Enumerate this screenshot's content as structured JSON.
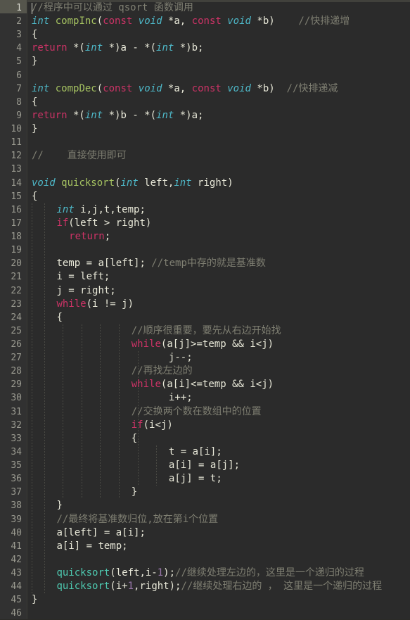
{
  "editor": {
    "name": "code-editor",
    "language": "C",
    "total_lines": 46,
    "active_line": 1,
    "theme": {
      "background": "#2b2b2b",
      "gutter_background": "#313131",
      "gutter_active": "#55554c",
      "foreground": "#e8e8d8",
      "comment": "#7f7f72",
      "keyword": "#cc3366",
      "type": "#4eb8c8",
      "function_def": "#a5c261",
      "function_call": "#4ec9b0",
      "number": "#9876aa",
      "indent_guide": "#4a4a44"
    }
  },
  "gutter": {
    "line_numbers": [
      "1",
      "2",
      "3",
      "4",
      "5",
      "6",
      "7",
      "8",
      "9",
      "10",
      "11",
      "12",
      "13",
      "14",
      "15",
      "16",
      "17",
      "18",
      "19",
      "20",
      "21",
      "22",
      "23",
      "24",
      "25",
      "26",
      "27",
      "28",
      "29",
      "30",
      "31",
      "32",
      "33",
      "34",
      "35",
      "36",
      "37",
      "38",
      "39",
      "40",
      "41",
      "42",
      "43",
      "44",
      "45",
      "46"
    ]
  },
  "lines": [
    {
      "n": 1,
      "indent": 0,
      "tokens": [
        {
          "t": "cmt",
          "s": "//程序中可以通过 qsort 函数调用"
        }
      ]
    },
    {
      "n": 2,
      "indent": 0,
      "tokens": [
        {
          "t": "type",
          "s": "int"
        },
        {
          "t": "plain",
          "s": " "
        },
        {
          "t": "fn",
          "s": "compInc"
        },
        {
          "t": "plain",
          "s": "("
        },
        {
          "t": "kw",
          "s": "const"
        },
        {
          "t": "plain",
          "s": " "
        },
        {
          "t": "type",
          "s": "void"
        },
        {
          "t": "plain",
          "s": " *a, "
        },
        {
          "t": "kw",
          "s": "const"
        },
        {
          "t": "plain",
          "s": " "
        },
        {
          "t": "type",
          "s": "void"
        },
        {
          "t": "plain",
          "s": " *b)    "
        },
        {
          "t": "cmt",
          "s": "//快排递增"
        }
      ]
    },
    {
      "n": 3,
      "indent": 0,
      "tokens": [
        {
          "t": "plain",
          "s": "{"
        }
      ]
    },
    {
      "n": 4,
      "indent": 0,
      "tokens": [
        {
          "t": "kw",
          "s": "return"
        },
        {
          "t": "plain",
          "s": " *("
        },
        {
          "t": "type",
          "s": "int"
        },
        {
          "t": "plain",
          "s": " *)a - *("
        },
        {
          "t": "type",
          "s": "int"
        },
        {
          "t": "plain",
          "s": " *)b;"
        }
      ]
    },
    {
      "n": 5,
      "indent": 0,
      "tokens": [
        {
          "t": "plain",
          "s": "}"
        }
      ]
    },
    {
      "n": 6,
      "indent": 0,
      "tokens": []
    },
    {
      "n": 7,
      "indent": 0,
      "tokens": [
        {
          "t": "type",
          "s": "int"
        },
        {
          "t": "plain",
          "s": " "
        },
        {
          "t": "fn",
          "s": "compDec"
        },
        {
          "t": "plain",
          "s": "("
        },
        {
          "t": "kw",
          "s": "const"
        },
        {
          "t": "plain",
          "s": " "
        },
        {
          "t": "type",
          "s": "void"
        },
        {
          "t": "plain",
          "s": " *a, "
        },
        {
          "t": "kw",
          "s": "const"
        },
        {
          "t": "plain",
          "s": " "
        },
        {
          "t": "type",
          "s": "void"
        },
        {
          "t": "plain",
          "s": " *b)  "
        },
        {
          "t": "cmt",
          "s": "//快排递减"
        }
      ]
    },
    {
      "n": 8,
      "indent": 0,
      "tokens": [
        {
          "t": "plain",
          "s": "{"
        }
      ]
    },
    {
      "n": 9,
      "indent": 0,
      "tokens": [
        {
          "t": "kw",
          "s": "return"
        },
        {
          "t": "plain",
          "s": " *("
        },
        {
          "t": "type",
          "s": "int"
        },
        {
          "t": "plain",
          "s": " *)b - *("
        },
        {
          "t": "type",
          "s": "int"
        },
        {
          "t": "plain",
          "s": " *)a;"
        }
      ]
    },
    {
      "n": 10,
      "indent": 0,
      "tokens": [
        {
          "t": "plain",
          "s": "}"
        }
      ]
    },
    {
      "n": 11,
      "indent": 0,
      "tokens": []
    },
    {
      "n": 12,
      "indent": 0,
      "tokens": [
        {
          "t": "cmt",
          "s": "//    直接使用即可"
        }
      ]
    },
    {
      "n": 13,
      "indent": 0,
      "tokens": []
    },
    {
      "n": 14,
      "indent": 0,
      "tokens": [
        {
          "t": "type",
          "s": "void"
        },
        {
          "t": "plain",
          "s": " "
        },
        {
          "t": "fn",
          "s": "quicksort"
        },
        {
          "t": "plain",
          "s": "("
        },
        {
          "t": "type",
          "s": "int"
        },
        {
          "t": "plain",
          "s": " left,"
        },
        {
          "t": "type",
          "s": "int"
        },
        {
          "t": "plain",
          "s": " right)"
        }
      ]
    },
    {
      "n": 15,
      "indent": 0,
      "tokens": [
        {
          "t": "plain",
          "s": "{"
        }
      ]
    },
    {
      "n": 16,
      "indent": 4,
      "tokens": [
        {
          "t": "type",
          "s": "int"
        },
        {
          "t": "plain",
          "s": " i,j,t,temp;"
        }
      ]
    },
    {
      "n": 17,
      "indent": 4,
      "tokens": [
        {
          "t": "kw",
          "s": "if"
        },
        {
          "t": "plain",
          "s": "(left > right)"
        }
      ]
    },
    {
      "n": 18,
      "indent": 6,
      "tokens": [
        {
          "t": "kw",
          "s": "return"
        },
        {
          "t": "plain",
          "s": ";"
        }
      ]
    },
    {
      "n": 19,
      "indent": 0,
      "tokens": []
    },
    {
      "n": 20,
      "indent": 4,
      "tokens": [
        {
          "t": "plain",
          "s": "temp = a[left]; "
        },
        {
          "t": "cmt",
          "s": "//temp中存的就是基准数"
        }
      ]
    },
    {
      "n": 21,
      "indent": 4,
      "tokens": [
        {
          "t": "plain",
          "s": "i = left;"
        }
      ]
    },
    {
      "n": 22,
      "indent": 4,
      "tokens": [
        {
          "t": "plain",
          "s": "j = right;"
        }
      ]
    },
    {
      "n": 23,
      "indent": 4,
      "tokens": [
        {
          "t": "kw",
          "s": "while"
        },
        {
          "t": "plain",
          "s": "(i != j)"
        }
      ]
    },
    {
      "n": 24,
      "indent": 4,
      "tokens": [
        {
          "t": "plain",
          "s": "{"
        }
      ]
    },
    {
      "n": 25,
      "indent": 16,
      "tokens": [
        {
          "t": "cmt",
          "s": "//顺序很重要，要先从右边开始找"
        }
      ]
    },
    {
      "n": 26,
      "indent": 16,
      "tokens": [
        {
          "t": "kw",
          "s": "while"
        },
        {
          "t": "plain",
          "s": "(a[j]>=temp && i<j)"
        }
      ]
    },
    {
      "n": 27,
      "indent": 22,
      "tokens": [
        {
          "t": "plain",
          "s": "j--;"
        }
      ]
    },
    {
      "n": 28,
      "indent": 16,
      "tokens": [
        {
          "t": "cmt",
          "s": "//再找左边的"
        }
      ]
    },
    {
      "n": 29,
      "indent": 16,
      "tokens": [
        {
          "t": "kw",
          "s": "while"
        },
        {
          "t": "plain",
          "s": "(a[i]<=temp && i<j)"
        }
      ]
    },
    {
      "n": 30,
      "indent": 22,
      "tokens": [
        {
          "t": "plain",
          "s": "i++;"
        }
      ]
    },
    {
      "n": 31,
      "indent": 16,
      "tokens": [
        {
          "t": "cmt",
          "s": "//交换两个数在数组中的位置"
        }
      ]
    },
    {
      "n": 32,
      "indent": 16,
      "tokens": [
        {
          "t": "kw",
          "s": "if"
        },
        {
          "t": "plain",
          "s": "(i<j)"
        }
      ]
    },
    {
      "n": 33,
      "indent": 16,
      "tokens": [
        {
          "t": "plain",
          "s": "{"
        }
      ]
    },
    {
      "n": 34,
      "indent": 22,
      "tokens": [
        {
          "t": "plain",
          "s": "t = a[i];"
        }
      ]
    },
    {
      "n": 35,
      "indent": 22,
      "tokens": [
        {
          "t": "plain",
          "s": "a[i] = a[j];"
        }
      ]
    },
    {
      "n": 36,
      "indent": 22,
      "tokens": [
        {
          "t": "plain",
          "s": "a[j] = t;"
        }
      ]
    },
    {
      "n": 37,
      "indent": 16,
      "tokens": [
        {
          "t": "plain",
          "s": "}"
        }
      ]
    },
    {
      "n": 38,
      "indent": 4,
      "tokens": [
        {
          "t": "plain",
          "s": "}"
        }
      ]
    },
    {
      "n": 39,
      "indent": 4,
      "tokens": [
        {
          "t": "cmt",
          "s": "//最终将基准数归位,放在第i个位置"
        }
      ]
    },
    {
      "n": 40,
      "indent": 4,
      "tokens": [
        {
          "t": "plain",
          "s": "a[left] = a[i];"
        }
      ]
    },
    {
      "n": 41,
      "indent": 4,
      "tokens": [
        {
          "t": "plain",
          "s": "a[i] = temp;"
        }
      ]
    },
    {
      "n": 42,
      "indent": 0,
      "tokens": []
    },
    {
      "n": 43,
      "indent": 4,
      "tokens": [
        {
          "t": "call",
          "s": "quicksort"
        },
        {
          "t": "plain",
          "s": "(left,i-"
        },
        {
          "t": "num",
          "s": "1"
        },
        {
          "t": "plain",
          "s": ");"
        },
        {
          "t": "cmt",
          "s": "//继续处理左边的，这里是一个递归的过程"
        }
      ]
    },
    {
      "n": 44,
      "indent": 4,
      "tokens": [
        {
          "t": "call",
          "s": "quicksort"
        },
        {
          "t": "plain",
          "s": "(i+"
        },
        {
          "t": "num",
          "s": "1"
        },
        {
          "t": "plain",
          "s": ",right);"
        },
        {
          "t": "cmt",
          "s": "//继续处理右边的 ， 这里是一个递归的过程"
        }
      ]
    },
    {
      "n": 45,
      "indent": 0,
      "tokens": [
        {
          "t": "plain",
          "s": "}"
        }
      ]
    },
    {
      "n": 46,
      "indent": 0,
      "tokens": []
    }
  ],
  "indent_guides": [
    {
      "col": 0,
      "from_line": 16,
      "to_line": 44
    },
    {
      "col": 2,
      "from_line": 16,
      "to_line": 44
    },
    {
      "col": 5,
      "from_line": 25,
      "to_line": 37
    },
    {
      "col": 8,
      "from_line": 25,
      "to_line": 37
    },
    {
      "col": 11,
      "from_line": 25,
      "to_line": 37
    },
    {
      "col": 14,
      "from_line": 25,
      "to_line": 37
    },
    {
      "col": 17,
      "from_line": 27,
      "to_line": 36
    },
    {
      "col": 20,
      "from_line": 34,
      "to_line": 36
    }
  ],
  "caret": {
    "line": 1,
    "column": 0
  }
}
